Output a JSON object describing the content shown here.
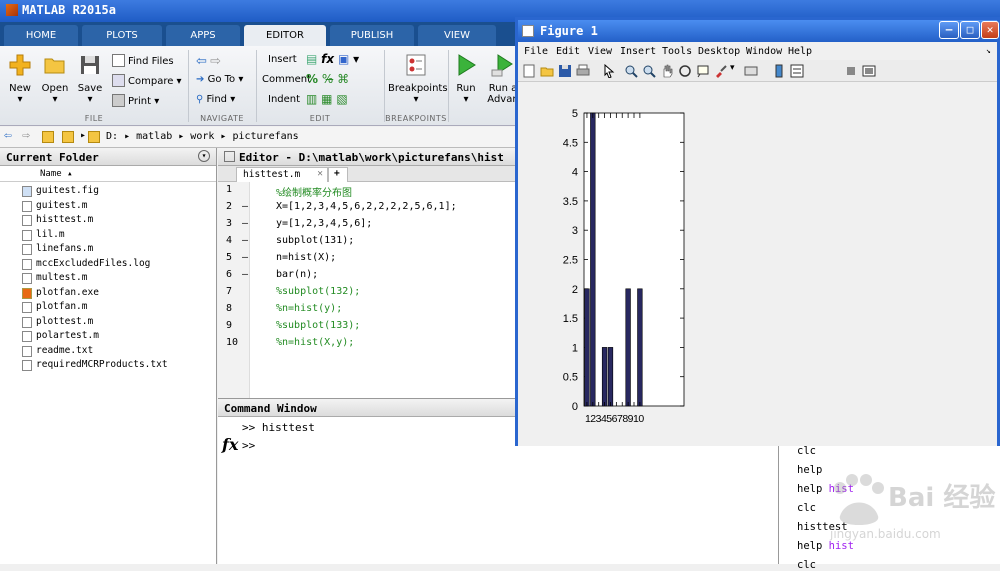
{
  "app": {
    "title": "MATLAB R2015a"
  },
  "ribbon_tabs": [
    "HOME",
    "PLOTS",
    "APPS",
    "EDITOR",
    "PUBLISH",
    "VIEW"
  ],
  "ribbon": {
    "new": "New",
    "open": "Open",
    "save": "Save",
    "find_files": "Find Files",
    "compare": "Compare",
    "print": "Print",
    "goto": "Go To",
    "find": "Find",
    "insert": "Insert",
    "comment": "Comment",
    "indent": "Indent",
    "breakpoints": "Breakpoints",
    "run": "Run",
    "run_advance": "Run a",
    "run_advance2": "Advan",
    "groups": {
      "file": "FILE",
      "navigate": "NAVIGATE",
      "edit": "EDIT",
      "breakpoints": "BREAKPOINTS"
    }
  },
  "address": {
    "drive": "D:",
    "p1": "matlab",
    "p2": "work",
    "p3": "picturefans"
  },
  "current_folder": {
    "title": "Current Folder",
    "column": "Name",
    "files": [
      "guitest.fig",
      "guitest.m",
      "histtest.m",
      "lil.m",
      "linefans.m",
      "mccExcludedFiles.log",
      "multest.m",
      "plotfan.exe",
      "plotfan.m",
      "plottest.m",
      "polartest.m",
      "readme.txt",
      "requiredMCRProducts.txt"
    ]
  },
  "editor": {
    "title": "Editor - D:\\matlab\\work\\picturefans\\hist",
    "tab": "histtest.m",
    "lines": [
      {
        "n": "1",
        "dash": "",
        "code": "%绘制概率分布图",
        "comment": true
      },
      {
        "n": "2",
        "dash": "–",
        "code": "X=[1,2,3,4,5,6,2,2,2,2,5,6,1];",
        "comment": false
      },
      {
        "n": "3",
        "dash": "–",
        "code": "y=[1,2,3,4,5,6];",
        "comment": false
      },
      {
        "n": "4",
        "dash": "–",
        "code": "subplot(131);",
        "comment": false
      },
      {
        "n": "5",
        "dash": "–",
        "code": "n=hist(X);",
        "comment": false
      },
      {
        "n": "6",
        "dash": "–",
        "code": "bar(n);",
        "comment": false
      },
      {
        "n": "7",
        "dash": "",
        "code": "%subplot(132);",
        "comment": true
      },
      {
        "n": "8",
        "dash": "",
        "code": "%n=hist(y);",
        "comment": true
      },
      {
        "n": "9",
        "dash": "",
        "code": "%subplot(133);",
        "comment": true
      },
      {
        "n": "10",
        "dash": "",
        "code": "%n=hist(X,y);",
        "comment": true
      }
    ]
  },
  "command_window": {
    "title": "Command Window",
    "line1": ">> histtest",
    "prompt": ">>",
    "fx": "fx"
  },
  "history": [
    {
      "cmd": "clc",
      "arg": ""
    },
    {
      "cmd": "help",
      "arg": ""
    },
    {
      "cmd": "help",
      "arg": "hist"
    },
    {
      "cmd": "clc",
      "arg": ""
    },
    {
      "cmd": "histtest",
      "arg": ""
    },
    {
      "cmd": "help",
      "arg": "hist"
    },
    {
      "cmd": "clc",
      "arg": ""
    }
  ],
  "figure": {
    "title": "Figure 1",
    "menu": [
      "File",
      "Edit",
      "View",
      "Insert",
      "Tools",
      "Desktop",
      "Window",
      "Help"
    ]
  },
  "chart_data": {
    "type": "bar",
    "categories": [
      "1",
      "2",
      "3",
      "4",
      "5",
      "6",
      "7",
      "8",
      "9",
      "10"
    ],
    "values": [
      2,
      5,
      0,
      1,
      1,
      0,
      0,
      2,
      0,
      2
    ],
    "xtick_text": "12345678910",
    "yticks": [
      "0",
      "0.5",
      "1",
      "1.5",
      "2",
      "2.5",
      "3",
      "3.5",
      "4",
      "4.5",
      "5"
    ],
    "ylim": [
      0,
      5
    ],
    "bar_color": "#282860"
  },
  "watermark": {
    "text": "Bai 经验",
    "url": "jingyan.baidu.com"
  },
  "colors": {
    "accent": "#2a66cf",
    "comment": "#228b22",
    "string_arg": "#a020f0"
  }
}
